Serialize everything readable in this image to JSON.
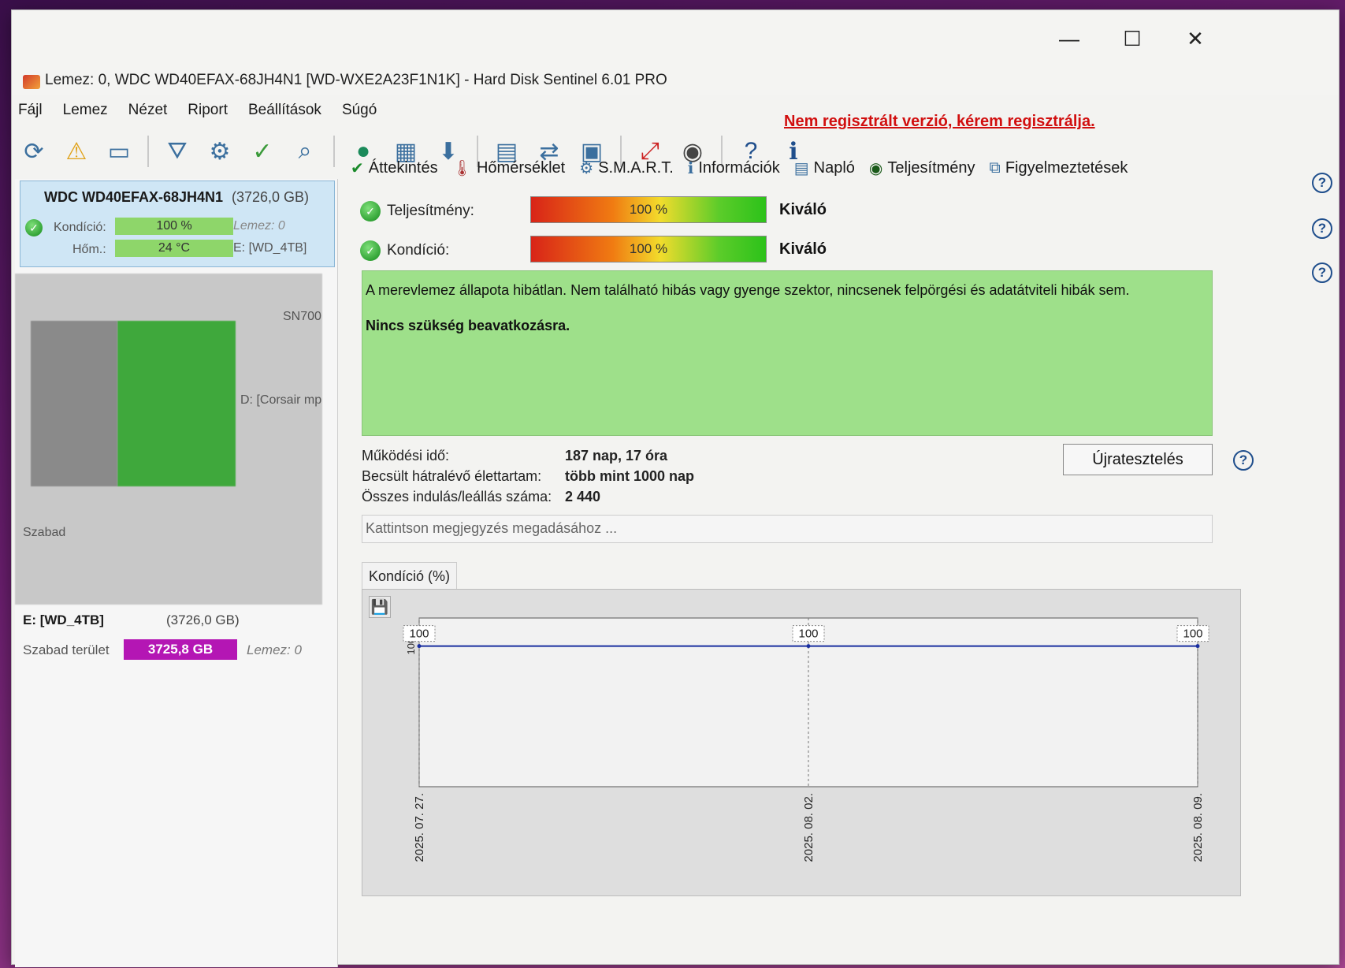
{
  "window": {
    "title": "Lemez: 0, WDC WD40EFAX-68JH4N1 [WD-WXE2A23F1N1K]  -  Hard Disk Sentinel 6.01 PRO",
    "minimize": "—",
    "maximize": "☐",
    "close": "✕"
  },
  "menu": [
    "Fájl",
    "Lemez",
    "Nézet",
    "Riport",
    "Beállítások",
    "Súgó"
  ],
  "register_link": "Nem regisztrált verzió, kérem regisztrálja.",
  "left": {
    "disk": {
      "name": "WDC WD40EFAX-68JH4N1",
      "size": "(3726,0 GB)",
      "condition_label": "Kondíció:",
      "condition_value": "100 %",
      "disk_label": "Lemez: 0",
      "temp_label": "Hőm.:",
      "temp_value": "24 °C",
      "volume_ref": "E: [WD_4TB]"
    },
    "partial": {
      "model_fragment": "SN700",
      "corsair_fragment": "D: [Corsair mp",
      "free_fragment": "Szabad"
    },
    "volume": {
      "name": "E: [WD_4TB]",
      "size": "(3726,0 GB)",
      "free_label": "Szabad terület",
      "free_value": "3725,8 GB",
      "disk": "Lemez: 0"
    }
  },
  "tabs": [
    "Áttekintés",
    "Hőmérséklet",
    "S.M.A.R.T.",
    "Információk",
    "Napló",
    "Teljesítmény",
    "Figyelmeztetések"
  ],
  "metrics": {
    "performance_label": "Teljesítmény:",
    "performance_value": "100 %",
    "performance_word": "Kiváló",
    "condition_label": "Kondíció:",
    "condition_value": "100 %",
    "condition_word": "Kiváló"
  },
  "status": {
    "line1": "A merevlemez állapota hibátlan. Nem található hibás vagy gyenge szektor, nincsenek felpörgési és adatátviteli hibák sem.",
    "line2": "Nincs szükség beavatkozásra."
  },
  "info": {
    "uptime_label": "Működési idő:",
    "uptime_value": "187 nap, 17 óra",
    "lifetime_label": "Becsült hátralévő élettartam:",
    "lifetime_value": "több mint 1000 nap",
    "starts_label": "Összes indulás/leállás száma:",
    "starts_value": "2 440"
  },
  "retest_button": "Újratesztelés",
  "note_placeholder": "Kattintson megjegyzés megadásához ...",
  "chart_tab": "Kondíció  (%)",
  "colors": {
    "status_green": "#9ee08a",
    "free_bar": "#b416b4",
    "line": "#1a2fa0",
    "register_red": "#d10f0f"
  },
  "chart_data": {
    "type": "line",
    "title": "Kondíció  (%)",
    "x": [
      "2025. 07. 27.",
      "2025. 08. 02.",
      "2025. 08. 09."
    ],
    "series": [
      {
        "values": [
          100,
          100,
          100
        ]
      }
    ],
    "data_labels": [
      "100",
      "100",
      "100"
    ],
    "ytick": "100",
    "ylim": [
      0,
      120
    ],
    "grid": true
  }
}
